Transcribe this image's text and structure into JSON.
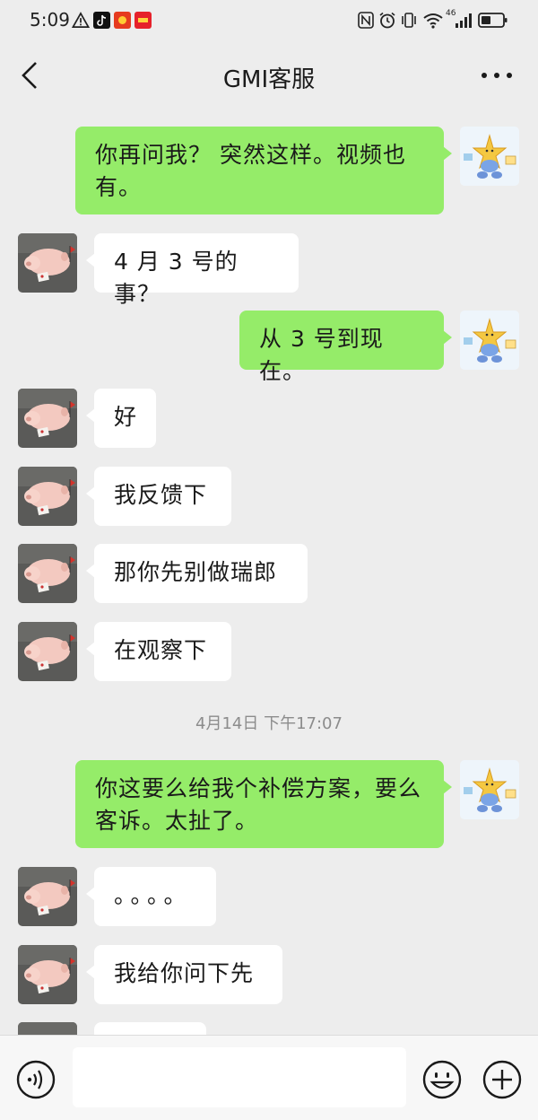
{
  "status_bar": {
    "time": "5:09",
    "network": "46",
    "icons": [
      "warning-icon",
      "tiktok-icon",
      "app-icon",
      "app-icon-2",
      "nfc-icon",
      "alarm-icon",
      "vibrate-icon",
      "wifi-icon",
      "signal-icon",
      "battery-icon"
    ]
  },
  "header": {
    "title": "GMI客服",
    "back_icon": "back-chevron-icon",
    "more_icon": "more-icon"
  },
  "messages": [
    {
      "side": "out",
      "text": "你再问我？ 突然这样。视频也有。"
    },
    {
      "side": "in",
      "text": "4 月 3 号的事？"
    },
    {
      "side": "out",
      "text": "从 3 号到现在。"
    },
    {
      "side": "in",
      "text": "好"
    },
    {
      "side": "in",
      "text": "我反馈下"
    },
    {
      "side": "in",
      "text": "那你先别做瑞郎"
    },
    {
      "side": "in",
      "text": "在观察下"
    },
    {
      "side": "out",
      "text": "你这要么给我个补偿方案，要么客诉。太扯了。"
    },
    {
      "side": "in",
      "text": "。。。。"
    },
    {
      "side": "in",
      "text": "我给你问下先"
    }
  ],
  "timestamp": "4月14日 下午17:07",
  "input_bar": {
    "icons": [
      "voice-icon",
      "emoji-icon",
      "plus-icon"
    ]
  },
  "colors": {
    "background": "#ededed",
    "outgoing_bubble": "#95ec69",
    "incoming_bubble": "#ffffff"
  }
}
